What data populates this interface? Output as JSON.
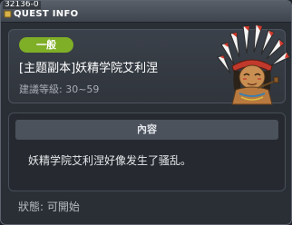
{
  "window": {
    "quest_code": "32136-0",
    "title": "QUEST INFO"
  },
  "header": {
    "category": "一般",
    "quest_title": "[主题副本]妖精学院艾利涅",
    "level_label": "建議等級:",
    "level_range": "30~59",
    "npc_icon": "chief-npc-portrait"
  },
  "content": {
    "header": "內容",
    "text": "妖精学院艾利涅好像发生了骚乱。"
  },
  "status": {
    "label": "狀態:",
    "value": "可開始"
  },
  "colors": {
    "category_badge": "#7fae27",
    "window_bg": "#2a2f36"
  }
}
